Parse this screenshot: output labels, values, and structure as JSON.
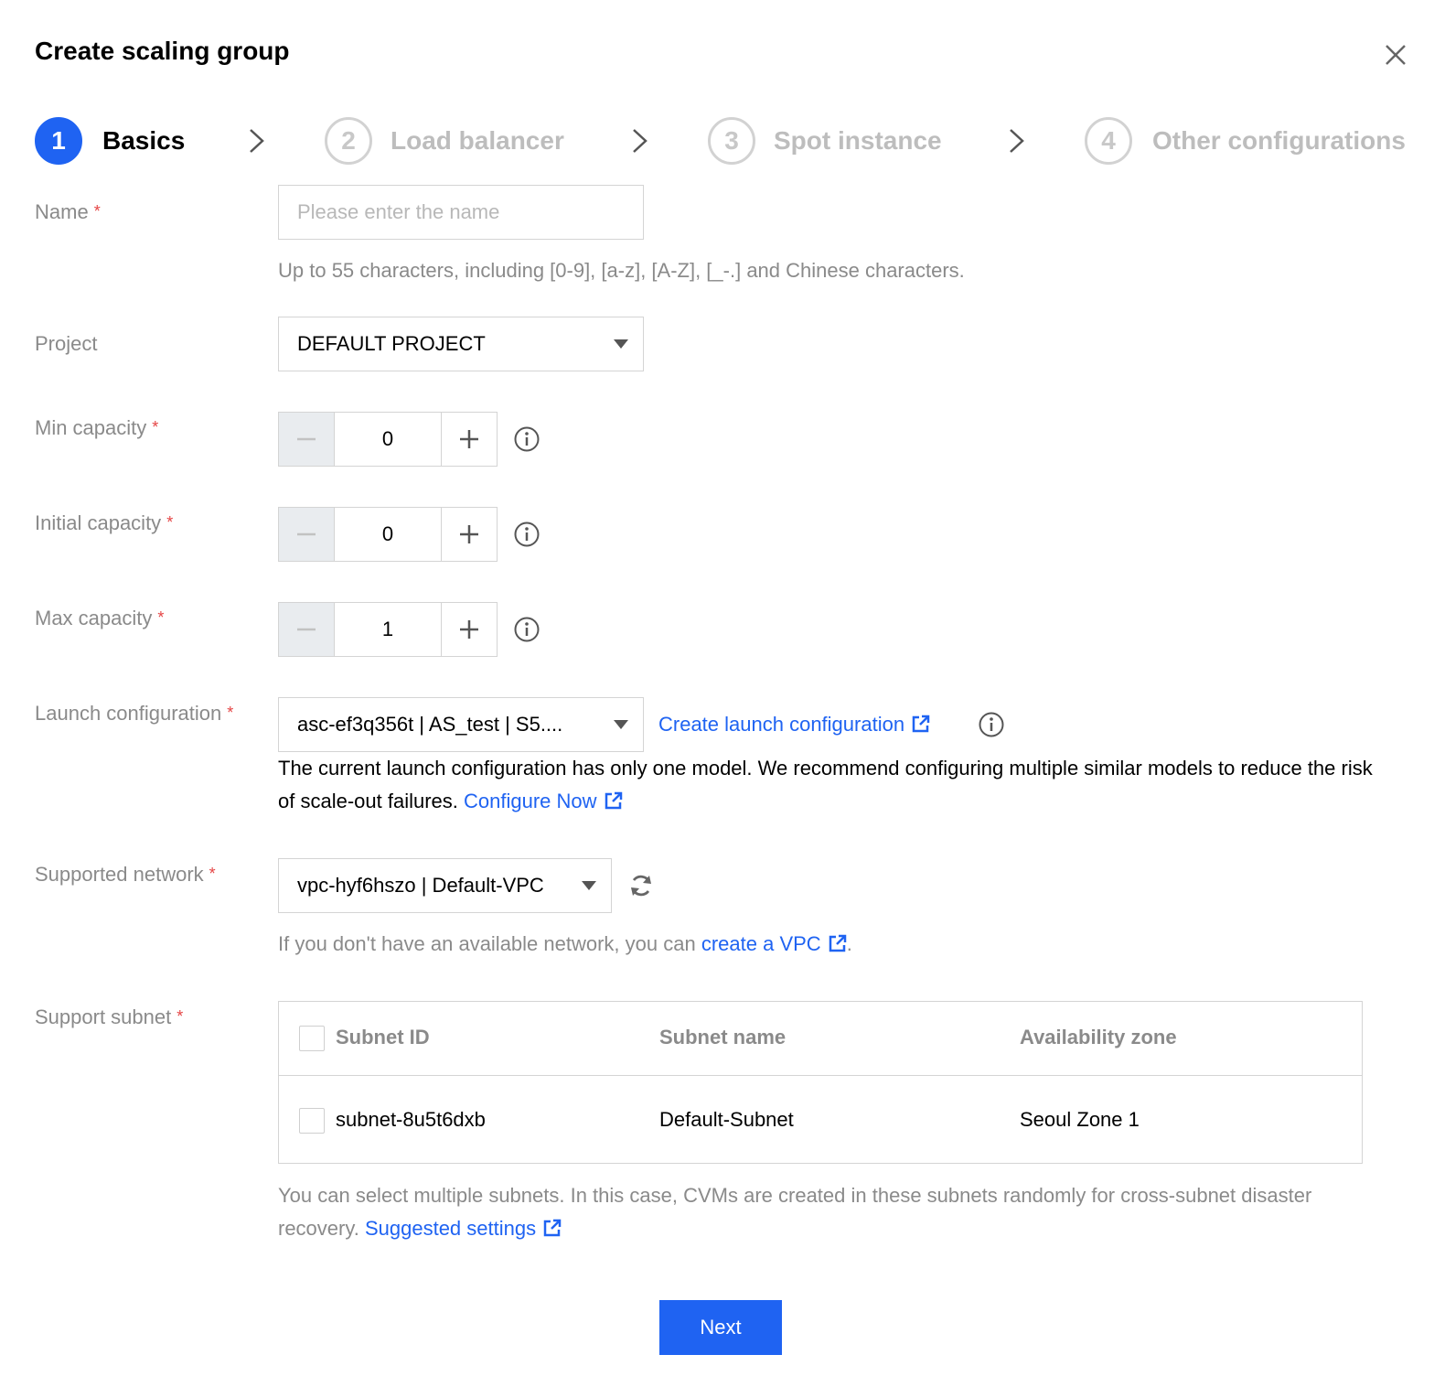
{
  "dialog": {
    "title": "Create scaling group"
  },
  "steps": [
    {
      "number": "1",
      "label": "Basics"
    },
    {
      "number": "2",
      "label": "Load balancer"
    },
    {
      "number": "3",
      "label": "Spot instance"
    },
    {
      "number": "4",
      "label": "Other configurations"
    }
  ],
  "form": {
    "name": {
      "label": "Name",
      "required_mark": "*",
      "placeholder": "Please enter the name",
      "hint": "Up to 55 characters, including [0-9], [a-z], [A-Z], [_-.] and Chinese characters."
    },
    "project": {
      "label": "Project",
      "value": "DEFAULT PROJECT"
    },
    "min_capacity": {
      "label": "Min capacity",
      "required_mark": "*",
      "value": "0"
    },
    "initial_capacity": {
      "label": "Initial capacity",
      "required_mark": "*",
      "value": "0"
    },
    "max_capacity": {
      "label": "Max capacity",
      "required_mark": "*",
      "value": "1"
    },
    "launch_configuration": {
      "label": "Launch configuration",
      "required_mark": "*",
      "value": "asc-ef3q356t | AS_test | S5....",
      "create_link": "Create launch configuration",
      "warning": "The current launch configuration has only one model. We recommend configuring multiple similar models to reduce the risk of scale-out failures.",
      "configure_link": "Configure Now"
    },
    "network": {
      "label": "Supported network",
      "required_mark": "*",
      "value": "vpc-hyf6hszo | Default-VPC",
      "hint_prefix": "If you don't have an available network, you can",
      "hint_link": "create a VPC",
      "hint_suffix": "."
    },
    "subnet": {
      "label": "Support subnet",
      "required_mark": "*",
      "columns": [
        "Subnet ID",
        "Subnet name",
        "Availability zone"
      ],
      "rows": [
        {
          "id": "subnet-8u5t6dxb",
          "name": "Default-Subnet",
          "zone": "Seoul Zone 1"
        }
      ],
      "hint": "You can select multiple subnets. In this case, CVMs are created in these subnets randomly for cross-subnet disaster recovery.",
      "hint_link": "Suggested settings"
    }
  },
  "footer": {
    "next_label": "Next"
  },
  "icons": {
    "close": "close-icon",
    "step_arrow": "chevron-right-icon",
    "dropdown": "caret-down-icon",
    "info": "info-icon",
    "external": "external-link-icon",
    "refresh": "refresh-icon",
    "minus": "minus-icon",
    "plus": "plus-icon"
  },
  "colors": {
    "primary": "#1f63f2",
    "required": "#e54545",
    "muted_text": "#8a8a8a",
    "border": "#d4d4d4",
    "disabled_bg": "#e9ecef"
  }
}
